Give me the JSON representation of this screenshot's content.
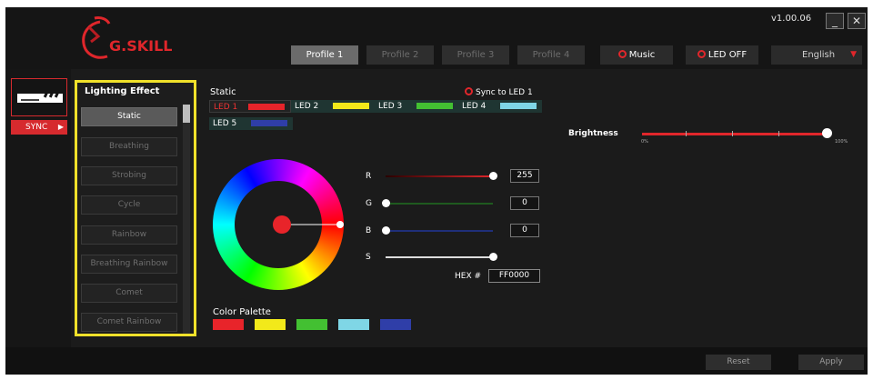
{
  "app": {
    "brand": "G.SKILL",
    "version": "v1.00.06",
    "minimize_glyph": "_",
    "close_glyph": "✕"
  },
  "profiles": [
    {
      "label": "Profile 1",
      "active": true
    },
    {
      "label": "Profile 2",
      "active": false
    },
    {
      "label": "Profile 3",
      "active": false
    },
    {
      "label": "Profile 4",
      "active": false
    }
  ],
  "controls": {
    "music_label": "Music",
    "led_off_label": "LED OFF",
    "language": "English"
  },
  "sidebar": {
    "sync_label": "SYNC"
  },
  "lighting": {
    "title": "Lighting Effect",
    "effects": [
      "Static",
      "Breathing",
      "Strobing",
      "Cycle",
      "Rainbow",
      "Breathing Rainbow",
      "Comet",
      "Comet Rainbow"
    ],
    "selected": "Static"
  },
  "static_panel": {
    "mode_label": "Static",
    "sync_label": "Sync to LED 1",
    "leds": [
      {
        "label": "LED 1",
        "color": "#e8242a"
      },
      {
        "label": "LED 2",
        "color": "#f2e91a"
      },
      {
        "label": "LED 3",
        "color": "#43c032"
      },
      {
        "label": "LED 4",
        "color": "#7fd6e6"
      },
      {
        "label": "LED 5",
        "color": "#2f3ea8"
      }
    ]
  },
  "sliders": {
    "r": {
      "label": "R",
      "value": "255",
      "level": 1.0
    },
    "g": {
      "label": "G",
      "value": "0",
      "level": 0.0
    },
    "b": {
      "label": "B",
      "value": "0",
      "level": 0.0
    },
    "s": {
      "label": "S",
      "level": 1.0
    }
  },
  "hex": {
    "label": "HEX #",
    "value": "FF0000"
  },
  "palette": {
    "label": "Color Palette",
    "colors": [
      "#e8242a",
      "#f2e91a",
      "#43c032",
      "#7fd6e6",
      "#2f3ea8"
    ]
  },
  "brightness": {
    "label": "Brightness",
    "min_label": "0%",
    "max_label": "100%",
    "level": 1.0
  },
  "footer": {
    "reset_label": "Reset",
    "apply_label": "Apply"
  },
  "colors": {
    "accent_red": "#e0262b",
    "highlight_yellow": "#f0e12a",
    "background": "#1b1b1b"
  }
}
